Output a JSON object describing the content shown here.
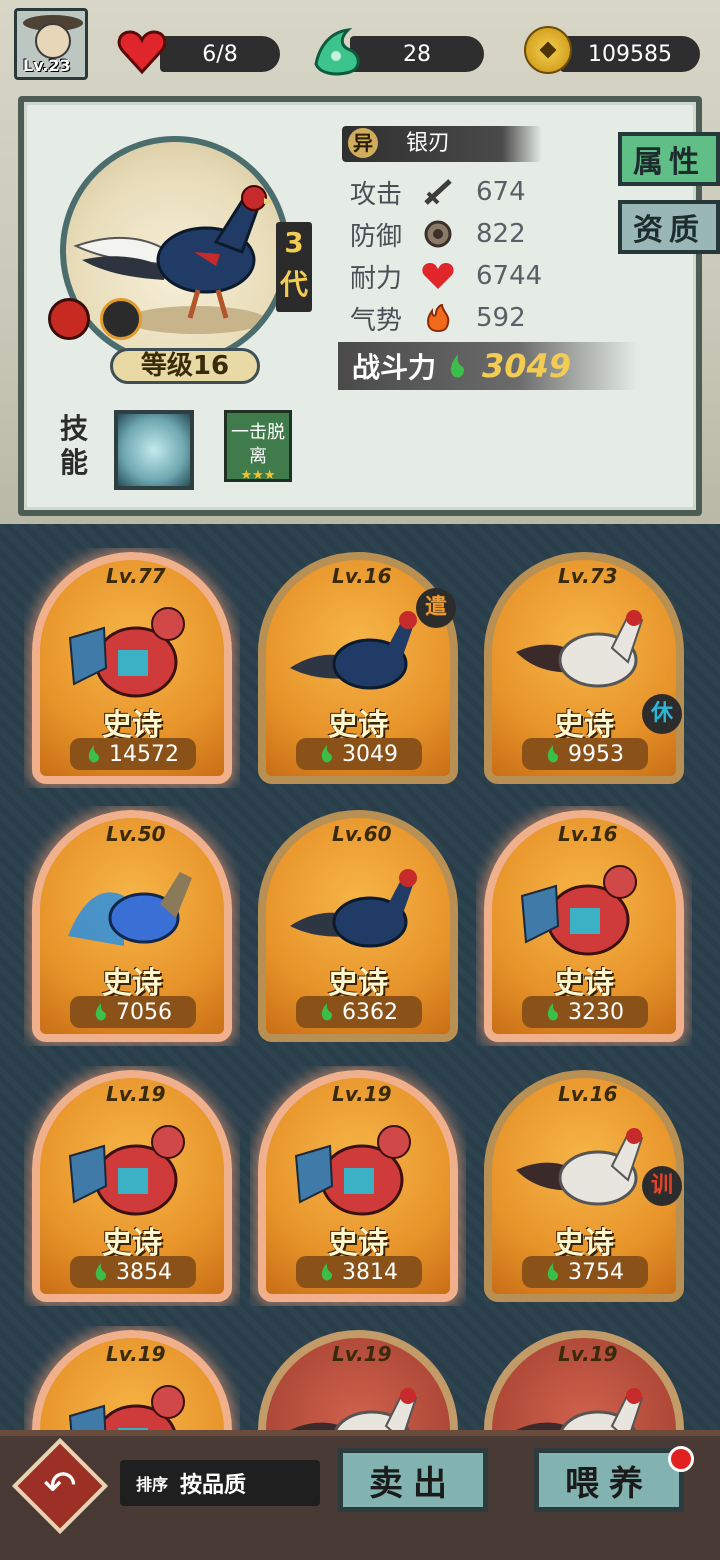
{
  "player": {
    "level": "Lv.23"
  },
  "resources": {
    "stamina": "6/8",
    "crystal": "28",
    "coins": "109585"
  },
  "detail": {
    "generation": "3代",
    "kind_badge": "异",
    "name": "银刃",
    "level_label": "等级16",
    "stats": [
      {
        "name": "攻击",
        "icon": "sword-icon",
        "value": "674"
      },
      {
        "name": "防御",
        "icon": "shield-icon",
        "value": "822"
      },
      {
        "name": "耐力",
        "icon": "heart-icon",
        "value": "6744"
      },
      {
        "name": "气势",
        "icon": "flame-icon",
        "value": "592"
      }
    ],
    "power_label": "战斗力",
    "power_value": "3049",
    "skills_label": "技能",
    "skill_2_text": "一击脱离",
    "skill_2_stars": "★★★"
  },
  "tabs": {
    "attributes": "属性",
    "aptitude": "资质"
  },
  "cards": [
    {
      "level": "Lv.77",
      "quality": "史诗",
      "power": "14572",
      "frame": "orange",
      "bird": "opera",
      "badge": ""
    },
    {
      "level": "Lv.16",
      "quality": "史诗",
      "power": "3049",
      "frame": "gold",
      "bird": "pheasant",
      "badge": "遣"
    },
    {
      "level": "Lv.73",
      "quality": "史诗",
      "power": "9953",
      "frame": "gold",
      "bird": "white",
      "badge": "休"
    },
    {
      "level": "Lv.50",
      "quality": "史诗",
      "power": "7056",
      "frame": "orange",
      "bird": "blue",
      "badge": ""
    },
    {
      "level": "Lv.60",
      "quality": "史诗",
      "power": "6362",
      "frame": "gold",
      "bird": "pheasant",
      "badge": ""
    },
    {
      "level": "Lv.16",
      "quality": "史诗",
      "power": "3230",
      "frame": "orange",
      "bird": "opera",
      "badge": ""
    },
    {
      "level": "Lv.19",
      "quality": "史诗",
      "power": "3854",
      "frame": "orange",
      "bird": "opera",
      "badge": ""
    },
    {
      "level": "Lv.19",
      "quality": "史诗",
      "power": "3814",
      "frame": "orange",
      "bird": "opera",
      "badge": ""
    },
    {
      "level": "Lv.16",
      "quality": "史诗",
      "power": "3754",
      "frame": "gold",
      "bird": "white",
      "badge": "训"
    },
    {
      "level": "Lv.19",
      "quality": "",
      "power": "",
      "frame": "orange",
      "bird": "opera",
      "badge": ""
    },
    {
      "level": "Lv.19",
      "quality": "",
      "power": "",
      "frame": "red",
      "bird": "white",
      "badge": ""
    },
    {
      "level": "Lv.19",
      "quality": "",
      "power": "",
      "frame": "red",
      "bird": "white",
      "badge": ""
    }
  ],
  "bottom": {
    "sort_key": "排序",
    "sort_value": "按品质",
    "sell": "卖出",
    "feed": "喂养"
  },
  "colors": {
    "accent_gold": "#f3cc54",
    "tab_active": "#5fbf86",
    "badge_blue": "#2fb4d6",
    "badge_orange": "#f09a2a",
    "badge_red": "#e0442a"
  }
}
